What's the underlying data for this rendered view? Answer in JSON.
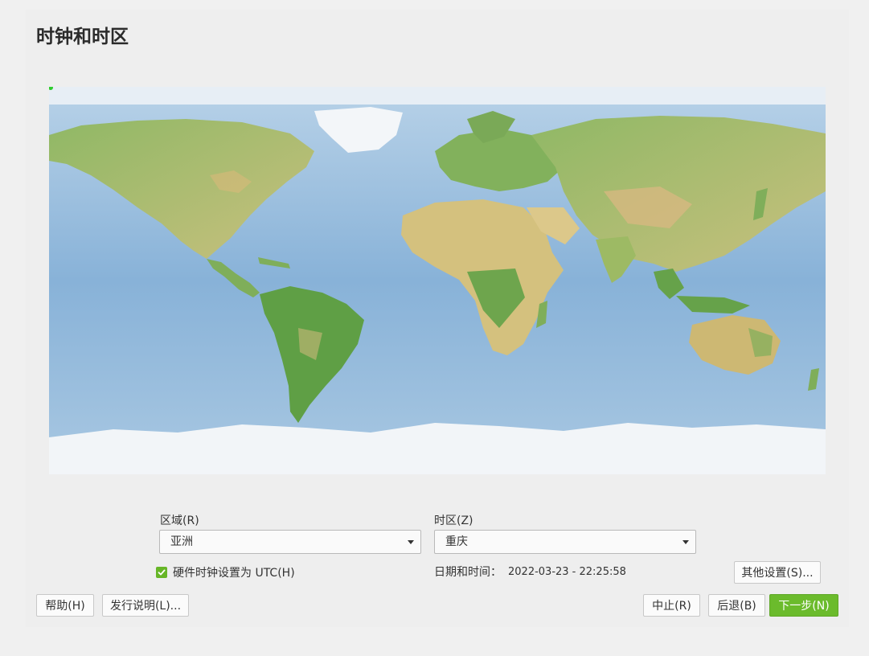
{
  "page": {
    "title": "时钟和时区"
  },
  "region": {
    "label": "区域(R)",
    "value": "亚洲"
  },
  "timezone": {
    "label": "时区(Z)",
    "value": "重庆"
  },
  "hardware_clock": {
    "checked": true,
    "label": "硬件时钟设置为 UTC(H)"
  },
  "datetime": {
    "label": "日期和时间：",
    "value": "2022-03-23 - 22:25:58"
  },
  "buttons": {
    "other_settings": "其他设置(S)...",
    "help": "帮助(H)",
    "release_notes": "发行说明(L)...",
    "abort": "中止(R)",
    "back": "后退(B)",
    "next": "下一步(N)"
  },
  "colors": {
    "accent": "#6bbb2c",
    "ocean": "#9fc3e0",
    "land": "#9bbd6a",
    "ice": "#f4f7fa"
  }
}
